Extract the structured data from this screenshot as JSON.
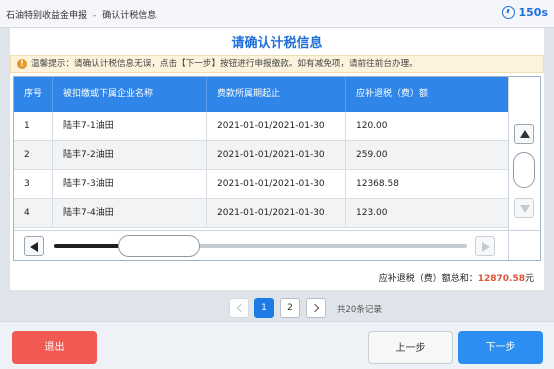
{
  "header": {
    "breadcrumb_root": "石油特别收益金申报",
    "breadcrumb_sep": "-",
    "breadcrumb_current": "确认计税信息",
    "timer": "150s"
  },
  "panel": {
    "title": "请确认计税信息",
    "tip": "温馨提示：请确认计税信息无误，点击【下一步】按钮进行申报缴款。如有减免项，请前往前台办理。"
  },
  "table": {
    "headers": [
      "序号",
      "被扣缴或下属企业名称",
      "费款所属期起止",
      "应补退税（费）额"
    ],
    "rows": [
      [
        "1",
        "陆丰7-1油田",
        "2021-01-01/2021-01-30",
        "120.00"
      ],
      [
        "2",
        "陆丰7-2油田",
        "2021-01-01/2021-01-30",
        "259.00"
      ],
      [
        "3",
        "陆丰7-3油田",
        "2021-01-01/2021-01-30",
        "12368.58"
      ],
      [
        "4",
        "陆丰7-4油田",
        "2021-01-01/2021-01-30",
        "123.00"
      ]
    ]
  },
  "total": {
    "label": "应补退税（费）额总和：",
    "amount": "12870.58",
    "unit": "元"
  },
  "pagination": {
    "pages": [
      "1",
      "2"
    ],
    "current_page": "1",
    "records": "共20条记录"
  },
  "buttons": {
    "exit": "退出",
    "prev_step": "上一步",
    "next_step": "下一步"
  },
  "colors": {
    "accent": "#1e6fd8",
    "header_bg": "#2f86e8",
    "amount": "#e0553a",
    "exit_btn": "#f05a52",
    "next_btn": "#2c8ef0"
  },
  "icons": {
    "timer": "clock-icon",
    "tip": "warning-icon",
    "scroll_up": "arrow-up-icon",
    "scroll_down": "arrow-down-icon",
    "scroll_left": "arrow-left-icon",
    "scroll_right": "arrow-right-icon",
    "page_prev": "chevron-left-icon",
    "page_next": "chevron-right-icon"
  }
}
